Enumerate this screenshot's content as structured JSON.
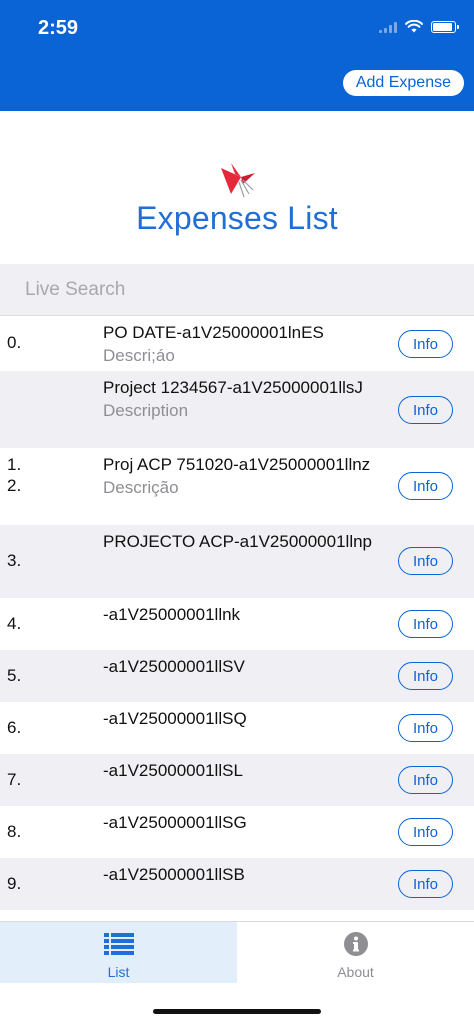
{
  "status_bar": {
    "time": "2:59"
  },
  "header": {
    "add_expense_label": "Add Expense"
  },
  "page": {
    "title": "Expenses List"
  },
  "search": {
    "placeholder": "Live Search"
  },
  "expenses": [
    {
      "index": "0.",
      "title": "PO DATE-a1V25000001lnES",
      "description": "Descri;áo",
      "info_label": "Info"
    },
    {
      "index": "1.",
      "title": "Project 1234567-a1V25000001llsJ",
      "description": "Description",
      "info_label": "Info"
    },
    {
      "index": "2.",
      "title": "Proj ACP 751020-a1V25000001llnz",
      "description": "Descrição",
      "info_label": "Info"
    },
    {
      "index": "3.",
      "title": "PROJECTO ACP-a1V25000001llnp",
      "description": "",
      "info_label": "Info"
    },
    {
      "index": "4.",
      "title": "-a1V25000001llnk",
      "description": "",
      "info_label": "Info"
    },
    {
      "index": "5.",
      "title": "-a1V25000001llSV",
      "description": "",
      "info_label": "Info"
    },
    {
      "index": "6.",
      "title": "-a1V25000001llSQ",
      "description": "",
      "info_label": "Info"
    },
    {
      "index": "7.",
      "title": "-a1V25000001llSL",
      "description": "",
      "info_label": "Info"
    },
    {
      "index": "8.",
      "title": "-a1V25000001llSG",
      "description": "",
      "info_label": "Info"
    },
    {
      "index": "9.",
      "title": "-a1V25000001llSB",
      "description": "",
      "info_label": "Info"
    }
  ],
  "tabs": [
    {
      "label": "List",
      "icon": "list-icon",
      "selected": true
    },
    {
      "label": "About",
      "icon": "info-circle-icon",
      "selected": false
    }
  ],
  "colors": {
    "primary": "#0a64d6",
    "accent_logo": "#e5293a",
    "row_alt": "#efeff4"
  }
}
